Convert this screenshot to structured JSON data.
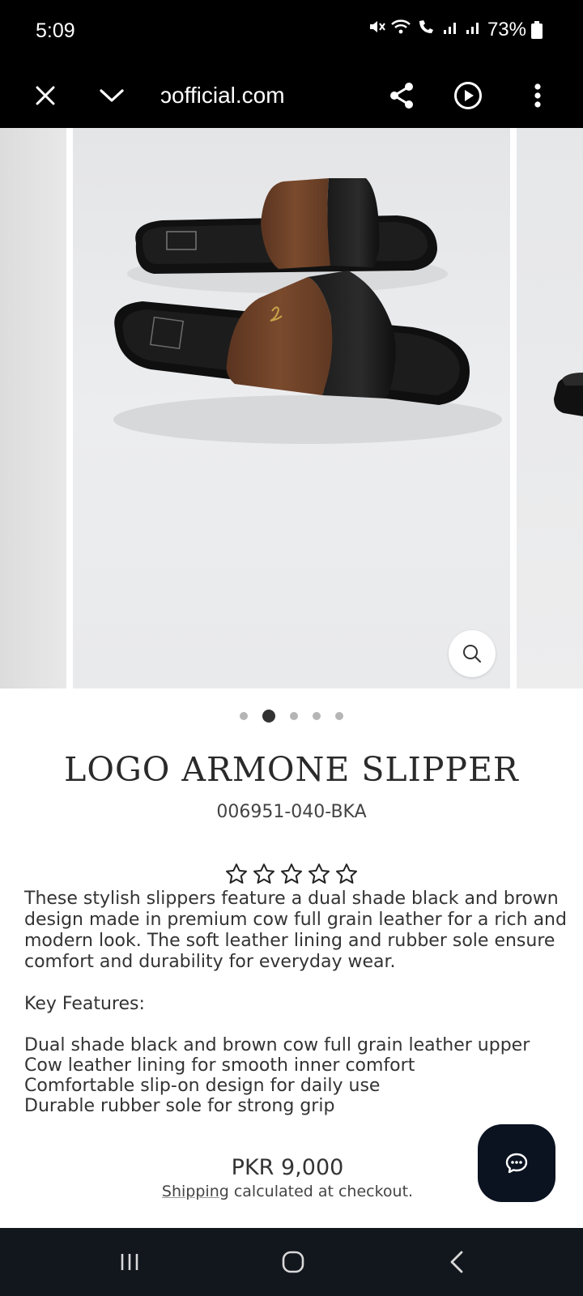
{
  "status_bar": {
    "time": "5:09",
    "battery": "73%",
    "icons": [
      "mute-icon",
      "wifi-icon",
      "wifi-call-icon",
      "signal-icon",
      "signal-icon",
      "battery-icon"
    ]
  },
  "browser": {
    "url": "ɔofficial.com",
    "icons": [
      "close-icon",
      "chevron-down-icon",
      "share-icon",
      "play-icon",
      "more-vertical-icon"
    ]
  },
  "gallery": {
    "slide_count": 5,
    "active_index": 1,
    "zoom_icon": "search-icon"
  },
  "product": {
    "title": "LOGO ARMONE SLIPPER",
    "sku": "006951-040-BKA",
    "rating": 0,
    "rating_max": 5,
    "description": "These stylish slippers feature a dual shade black and brown design made in premium cow full grain leather for a rich and modern look. The soft leather lining and rubber sole ensure comfort and durability for everyday wear.",
    "key_features_label": "Key Features:",
    "features": [
      "Dual shade black and brown cow full grain leather upper",
      "Cow leather lining for smooth inner comfort",
      "Comfortable slip-on design for daily use",
      "Durable rubber sole for strong grip"
    ],
    "price": "PKR 9,000",
    "shipping_link": "Shipping",
    "shipping_text": " calculated at checkout."
  },
  "chat": {
    "icon": "chat-bubble-icon"
  },
  "nav_bar": {
    "icons": [
      "recent-apps-icon",
      "home-icon",
      "back-icon"
    ]
  },
  "colors": {
    "status_bg": "#000000",
    "nav_bg": "#12161d",
    "chat_bg": "#0b1220",
    "leather_brown": "#6b3f26",
    "leather_black": "#151515"
  }
}
